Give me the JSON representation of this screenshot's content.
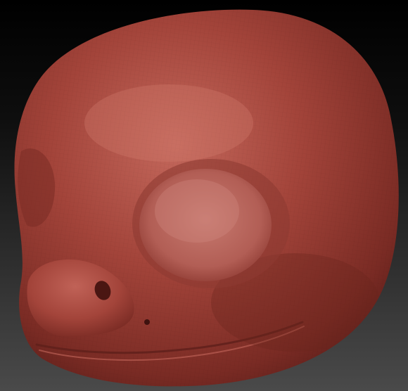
{
  "viewport": {
    "background_top": "#000000",
    "background_bottom": "#4a4a4a",
    "subject": "sculpted-head-model",
    "material_color": "#a3443a",
    "material_highlight": "#c4685c",
    "material_shadow": "#5e1f1a",
    "eye_socket_color": "#b25e55"
  }
}
